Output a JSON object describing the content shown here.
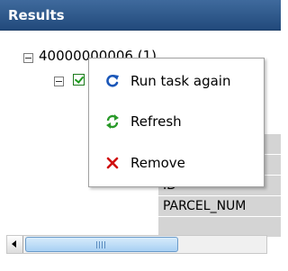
{
  "panel": {
    "title": "Results"
  },
  "tree": {
    "root_label": "40000000006 (1)",
    "fields": [
      "ID",
      "PARCEL_NUM"
    ]
  },
  "context_menu": {
    "items": [
      {
        "label": "Run task again",
        "icon": "refresh-arrow-icon",
        "color": "#1a56b8"
      },
      {
        "label": "Refresh",
        "icon": "green-refresh-icon",
        "color": "#2a9a2a"
      },
      {
        "label": "Remove",
        "icon": "red-x-icon",
        "color": "#d01010"
      }
    ]
  },
  "scrollbar": {
    "position": "left"
  }
}
